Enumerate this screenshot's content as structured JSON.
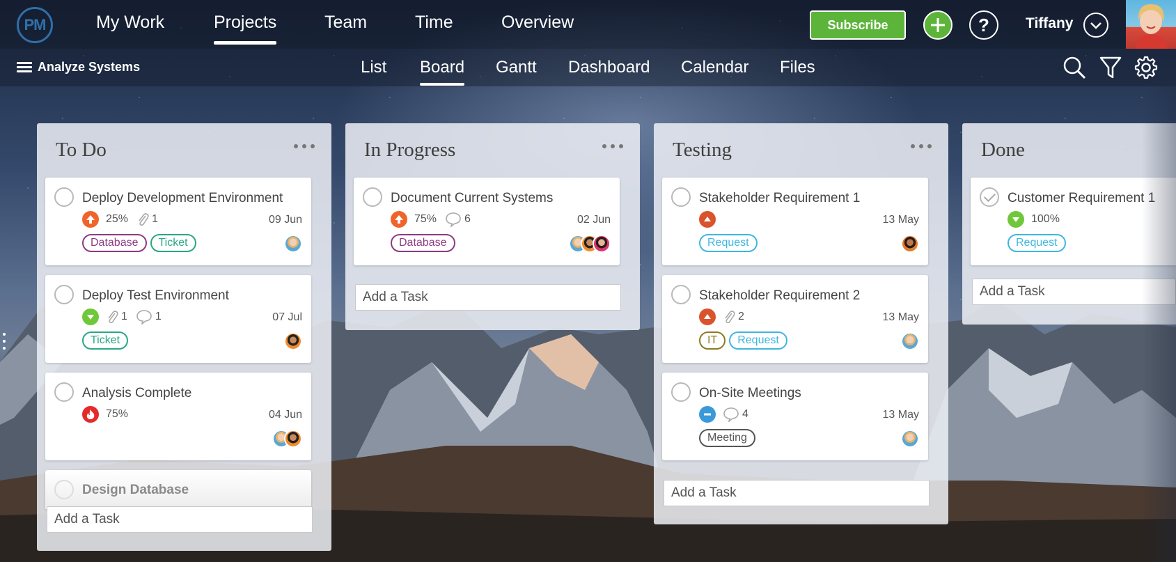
{
  "app": {
    "logo_text": "PM"
  },
  "topnav": {
    "items": [
      {
        "label": "My Work"
      },
      {
        "label": "Projects"
      },
      {
        "label": "Team"
      },
      {
        "label": "Time"
      },
      {
        "label": "Overview"
      }
    ],
    "active": "Projects",
    "subscribe_label": "Subscribe",
    "help_label": "?",
    "user_name": "Tiffany"
  },
  "subnav": {
    "project_name": "Analyze Systems",
    "tabs": [
      {
        "label": "List"
      },
      {
        "label": "Board"
      },
      {
        "label": "Gantt"
      },
      {
        "label": "Dashboard"
      },
      {
        "label": "Calendar"
      },
      {
        "label": "Files"
      }
    ],
    "active": "Board",
    "icons": [
      "search-icon",
      "filter-icon",
      "gear-icon"
    ]
  },
  "colors": {
    "green": "#5cb43a",
    "priority_high": "#f0642c",
    "priority_critical": "#e52a2a",
    "priority_low": "#6fc73a",
    "priority_medium": "#d9532b",
    "priority_none": "#3a9ad9"
  },
  "columns": [
    {
      "title": "To Do",
      "add_task": "Add a Task",
      "cards": [
        {
          "title": "Deploy Development Environment",
          "priority": "high",
          "progress": "25%",
          "attachments": "1",
          "comments": "",
          "date": "09 Jun",
          "tags": [
            "Database",
            "Ticket"
          ]
        },
        {
          "title": "Deploy Test Environment",
          "priority": "low",
          "progress": "",
          "attachments": "1",
          "comments": "1",
          "date": "07 Jul",
          "tags": [
            "Ticket"
          ]
        },
        {
          "title": "Analysis Complete",
          "priority": "critical",
          "progress": "75%",
          "attachments": "",
          "comments": "",
          "date": "04 Jun",
          "tags": []
        },
        {
          "title": "Design Database"
        }
      ]
    },
    {
      "title": "In Progress",
      "add_task": "Add a Task",
      "cards": [
        {
          "title": "Document Current Systems",
          "priority": "high",
          "progress": "75%",
          "attachments": "",
          "comments": "6",
          "date": "02 Jun",
          "tags": [
            "Database"
          ]
        }
      ]
    },
    {
      "title": "Testing",
      "add_task": "Add a Task",
      "cards": [
        {
          "title": "Stakeholder Requirement 1",
          "priority": "medium",
          "progress": "",
          "attachments": "",
          "comments": "",
          "date": "13 May",
          "tags": [
            "Request"
          ]
        },
        {
          "title": "Stakeholder Requirement 2",
          "priority": "medium",
          "progress": "",
          "attachments": "2",
          "comments": "",
          "date": "13 May",
          "tags": [
            "IT",
            "Request"
          ]
        },
        {
          "title": "On-Site Meetings",
          "priority": "none",
          "progress": "",
          "attachments": "",
          "comments": "4",
          "date": "13 May",
          "tags": [
            "Meeting"
          ]
        }
      ]
    },
    {
      "title": "Done",
      "add_task": "Add a Task",
      "cards": [
        {
          "title": "Customer Requirement 1",
          "priority": "low",
          "progress": "100%",
          "attachments": "",
          "comments": "",
          "date": "",
          "tags": [
            "Request"
          ]
        }
      ]
    }
  ]
}
